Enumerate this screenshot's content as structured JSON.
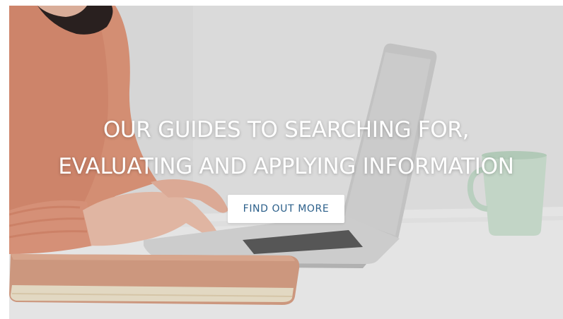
{
  "hero": {
    "title_line1": "OUR GUIDES TO SEARCHING FOR,",
    "title_line2": "EVALUATING AND APPLYING INFORMATION",
    "cta_label": "FIND OUT MORE"
  },
  "colors": {
    "title_text": "#ffffff",
    "button_bg": "#ffffff",
    "button_text": "#2b5f8a"
  },
  "icons": [
    "person-typing-photo",
    "laptop",
    "notebook",
    "mug"
  ]
}
